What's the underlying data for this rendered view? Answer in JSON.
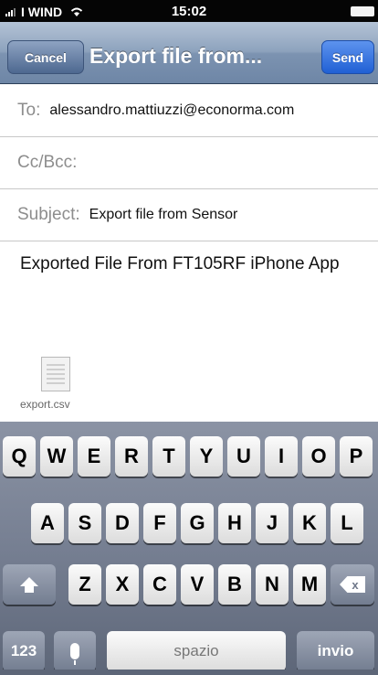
{
  "status_bar": {
    "carrier": "I WIND",
    "time": "15:02"
  },
  "nav": {
    "cancel_label": "Cancel",
    "title": "Export file from...",
    "send_label": "Send"
  },
  "compose": {
    "to_label": "To:",
    "to_value": "alessandro.mattiuzzi@econorma.com",
    "cc_label": "Cc/Bcc:",
    "subject_label": "Subject:",
    "subject_value": "Export file from Sensor",
    "body": "Exported File From FT105RF iPhone App",
    "attachment_name": "export.csv"
  },
  "keyboard": {
    "row1": [
      "Q",
      "W",
      "E",
      "R",
      "T",
      "Y",
      "U",
      "I",
      "O",
      "P"
    ],
    "row2": [
      "A",
      "S",
      "D",
      "F",
      "G",
      "H",
      "J",
      "K",
      "L"
    ],
    "row3": [
      "Z",
      "X",
      "C",
      "V",
      "B",
      "N",
      "M"
    ],
    "numbers_label": "123",
    "space_label": "spazio",
    "return_label": "invio",
    "backspace_glyph": "x"
  }
}
